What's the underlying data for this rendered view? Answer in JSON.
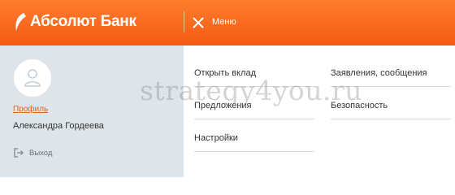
{
  "header": {
    "logo_text": "Абсолют Банк",
    "menu_label": "Меню"
  },
  "sidebar": {
    "profile_link": "Профиль",
    "user_name": "Александра Гордеева",
    "logout_label": "Выход"
  },
  "menu": {
    "items": [
      {
        "label": "Открыть вклад"
      },
      {
        "label": "Предложения"
      },
      {
        "label": "Настройки"
      },
      {
        "label": "Заявления, сообщения"
      },
      {
        "label": "Безопасность"
      }
    ]
  },
  "watermark": "strategy4you.ru",
  "colors": {
    "header": "#f35a13",
    "sidebar": "#dde5ea",
    "link": "#e0641a"
  }
}
